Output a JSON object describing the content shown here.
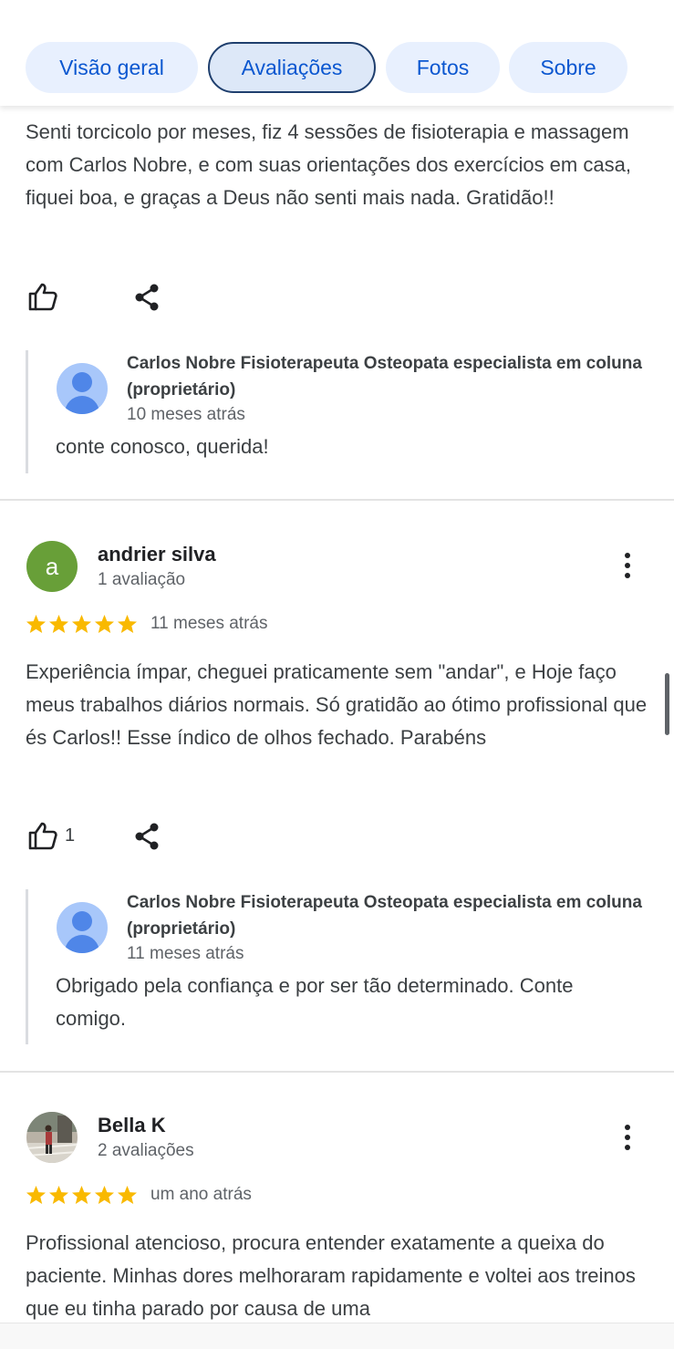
{
  "tabs": [
    {
      "label": "Visão geral"
    },
    {
      "label": "Avaliações"
    },
    {
      "label": "Fotos"
    },
    {
      "label": "Sobre"
    }
  ],
  "review0": {
    "text": "Senti torcicolo por meses, fiz 4 sessões de fisioterapia e massagem com Carlos Nobre, e com suas orientações dos exercícios em casa, fiquei boa, e graças a Deus não senti mais nada. Gratidão!!",
    "reply": {
      "owner": "Carlos Nobre Fisioterapeuta Osteopata especialista em coluna (proprietário)",
      "time": "10 meses atrás",
      "text": "conte conosco, querida!"
    }
  },
  "review1": {
    "avatar_letter": "a",
    "avatar_color": "#689f38",
    "name": "andrier silva",
    "count": "1 avaliação",
    "rating": 5,
    "time": "11 meses atrás",
    "text": "Experiência ímpar, cheguei praticamente sem \"andar\", e Hoje faço meus trabalhos diários normais. Só gratidão ao ótimo profissional que és Carlos!! Esse índico de olhos fechado. Parabéns",
    "likes": "1",
    "reply": {
      "owner": "Carlos Nobre Fisioterapeuta Osteopata especialista em coluna (proprietário)",
      "time": "11 meses atrás",
      "text": "Obrigado pela confiança e por ser tão determinado. Conte comigo."
    }
  },
  "review2": {
    "name": "Bella K",
    "count": "2 avaliações",
    "rating": 5,
    "time": "um ano atrás",
    "text": "Profissional atencioso, procura entender exatamente a queixa do paciente. Minhas dores melhoraram rapidamente e voltei aos treinos que eu tinha parado por causa de uma"
  },
  "colors": {
    "star": "#f9b900",
    "chip_bg": "#e8f0fe",
    "chip_text": "#0b57d0"
  }
}
